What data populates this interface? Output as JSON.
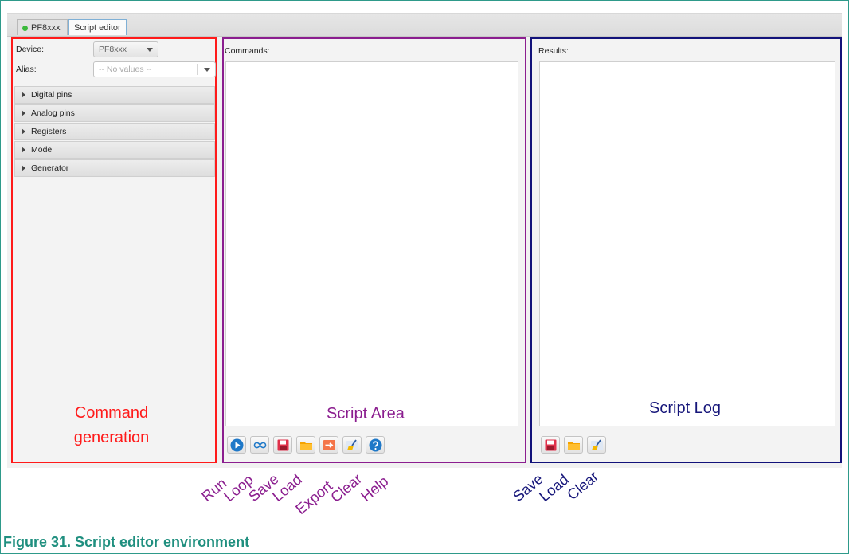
{
  "tabs": [
    {
      "label": "PF8xxx",
      "status_color": "#3cb93c"
    },
    {
      "label": "Script editor"
    }
  ],
  "left_panel": {
    "device_label": "Device:",
    "device_value": "PF8xxx",
    "alias_label": "Alias:",
    "alias_placeholder": "-- No values --",
    "sections": [
      "Digital pins",
      "Analog pins",
      "Registers",
      "Mode",
      "Generator"
    ],
    "annotation_line1": "Command",
    "annotation_line2": "generation",
    "annotation_color": "#ff1a1a"
  },
  "middle_panel": {
    "label": "Commands:",
    "annotation": "Script Area",
    "annotation_color": "#8b1e8f",
    "buttons": [
      {
        "name": "run",
        "icon": "play-circle-icon",
        "annotation": "Run"
      },
      {
        "name": "loop",
        "icon": "infinity-icon",
        "annotation": "Loop"
      },
      {
        "name": "save",
        "icon": "floppy-disk-icon",
        "annotation": "Save"
      },
      {
        "name": "load",
        "icon": "folder-icon",
        "annotation": "Load"
      },
      {
        "name": "export",
        "icon": "arrow-right-icon",
        "annotation": "Export"
      },
      {
        "name": "clear",
        "icon": "broom-icon",
        "annotation": "Clear"
      },
      {
        "name": "help",
        "icon": "question-circle-icon",
        "annotation": "Help"
      }
    ]
  },
  "right_panel": {
    "label": "Results:",
    "annotation": "Script Log",
    "annotation_color": "#16167a",
    "buttons": [
      {
        "name": "save",
        "icon": "floppy-disk-icon",
        "annotation": "Save"
      },
      {
        "name": "load",
        "icon": "folder-icon",
        "annotation": "Load"
      },
      {
        "name": "clear",
        "icon": "broom-icon",
        "annotation": "Clear"
      }
    ]
  },
  "caption": "Figure 31.  Script editor environment"
}
